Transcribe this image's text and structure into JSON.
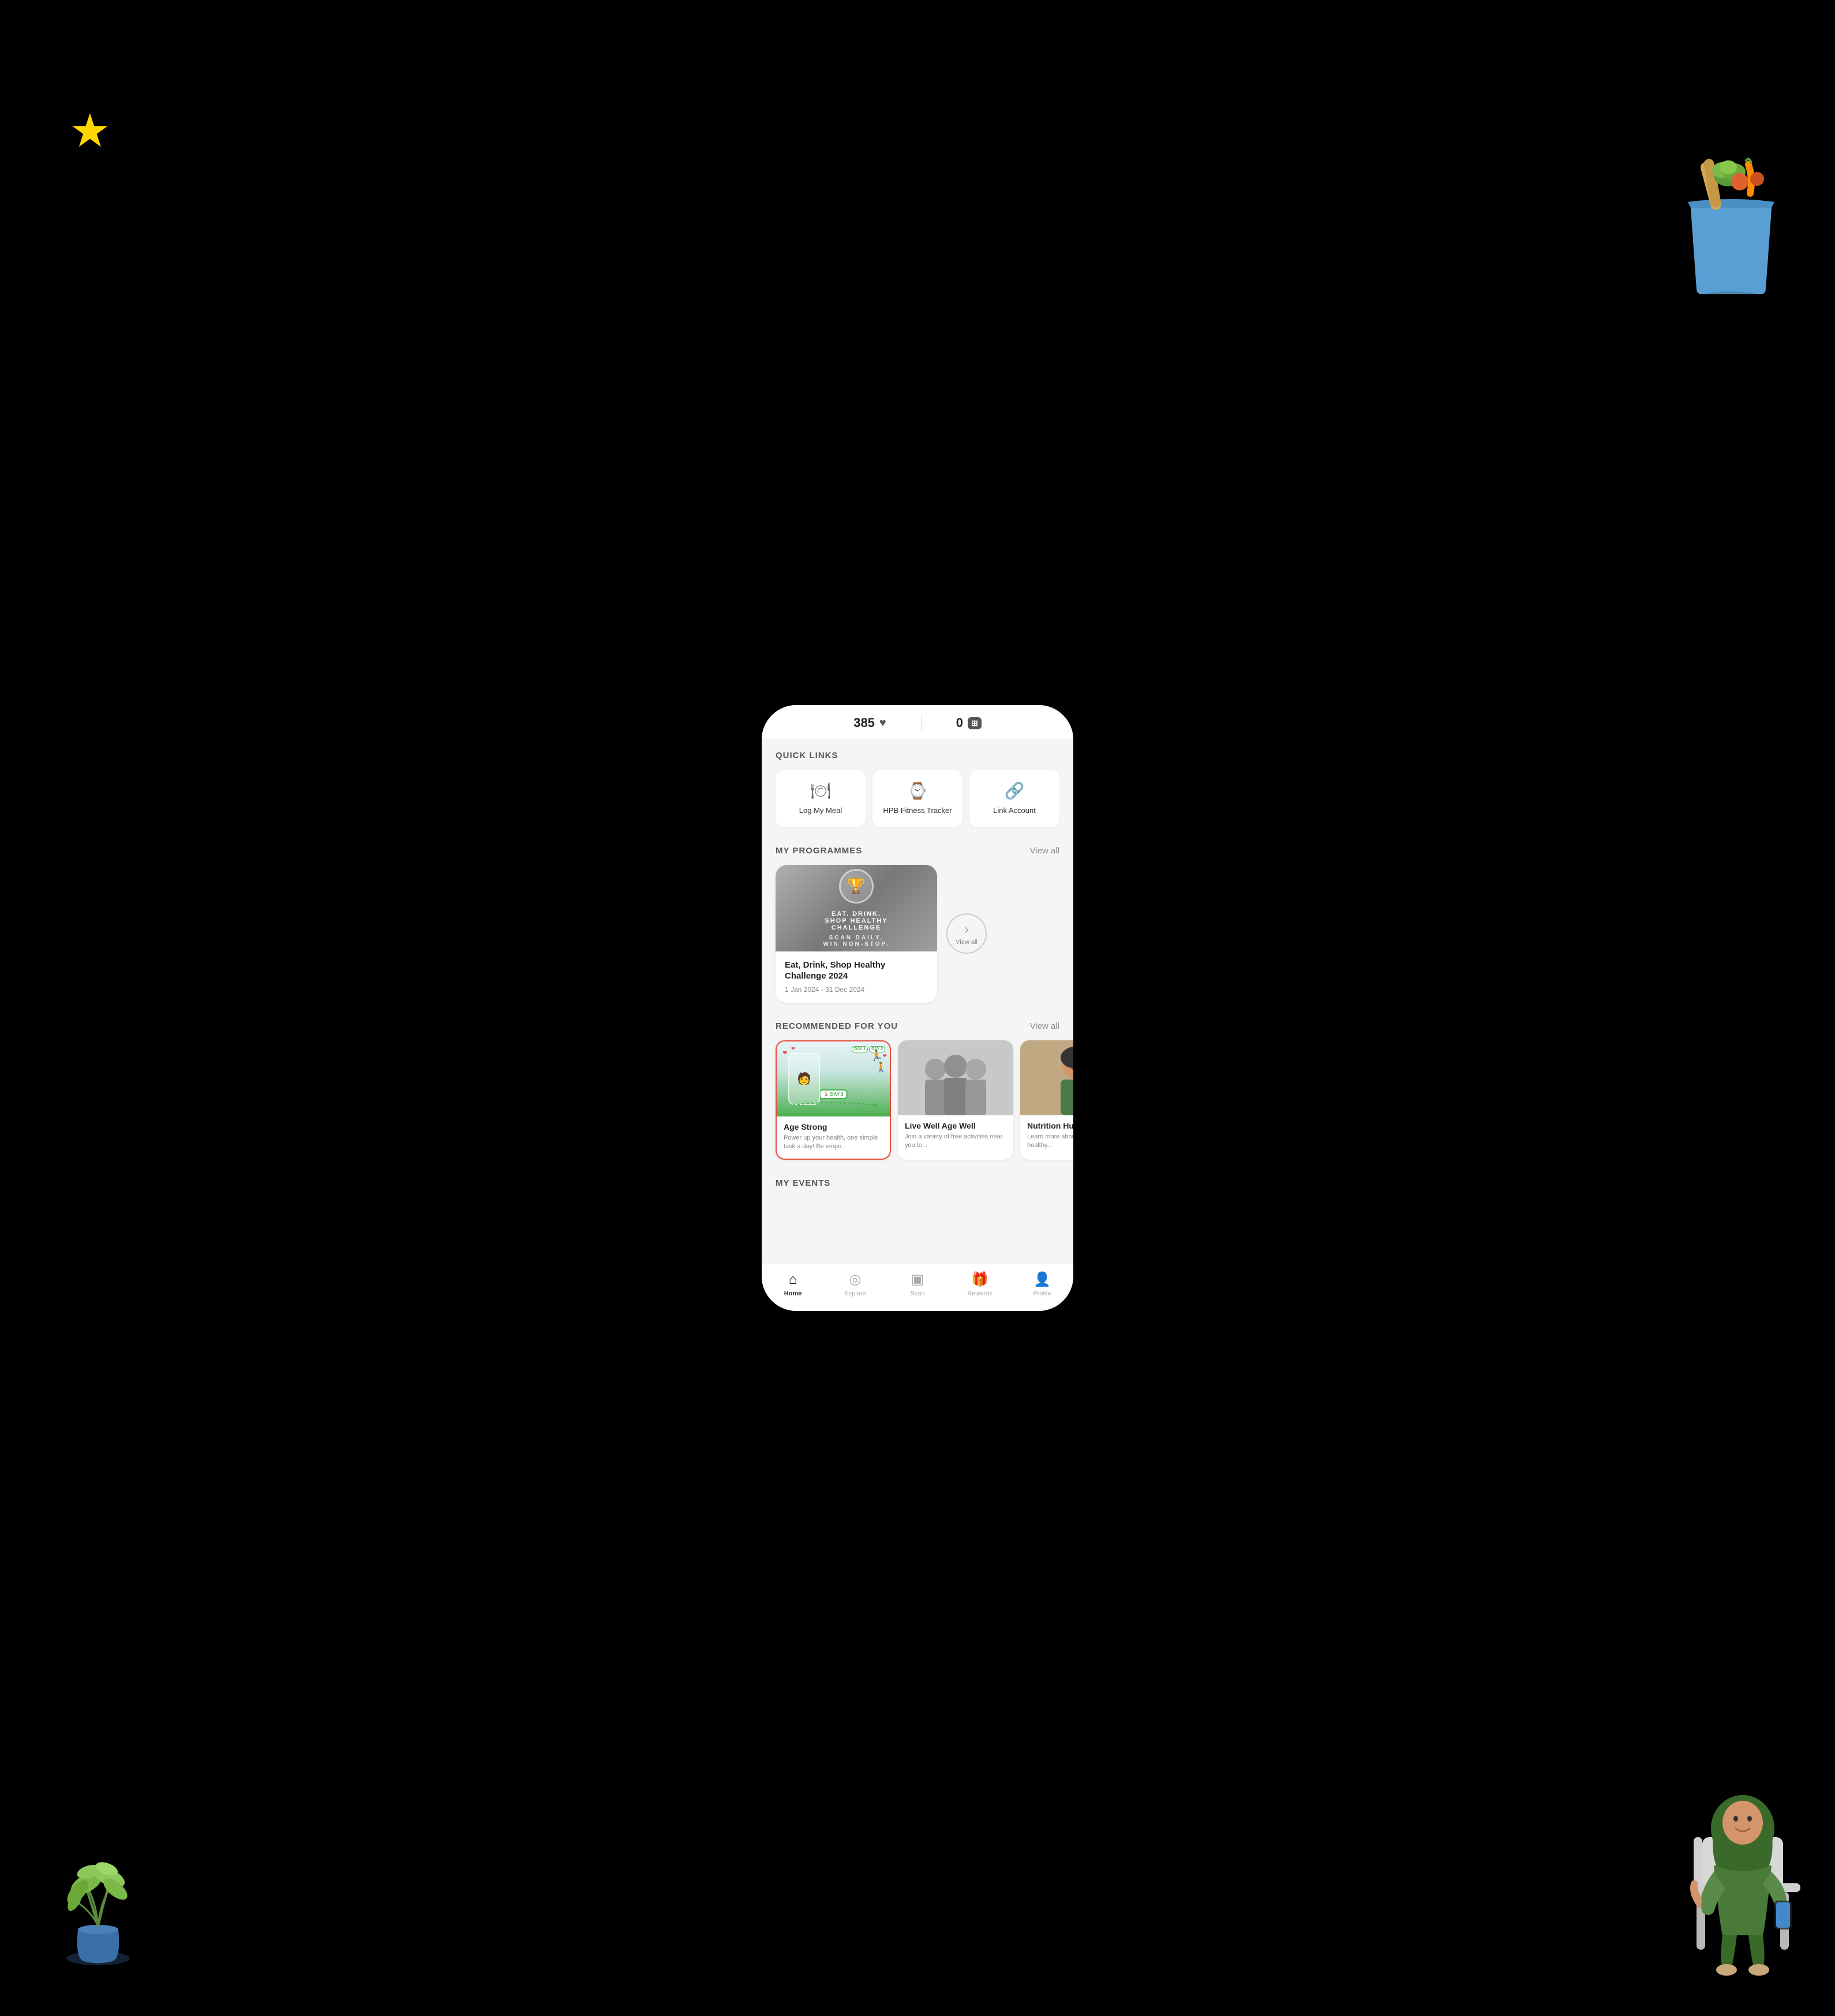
{
  "statusBar": {
    "points": "385",
    "coins": "0",
    "heartIcon": "♥",
    "coinIcon": "⊞"
  },
  "quickLinks": {
    "sectionTitle": "QUICK LINKS",
    "items": [
      {
        "id": "log-meal",
        "label": "Log My Meal",
        "icon": "🍽"
      },
      {
        "id": "hpb-fitness",
        "label": "HPB Fitness Tracker",
        "icon": "⌚"
      },
      {
        "id": "link-account",
        "label": "Link Account",
        "icon": "🔗"
      }
    ]
  },
  "myProgrammes": {
    "sectionTitle": "MY PROGRAMMES",
    "viewAll": "View all",
    "items": [
      {
        "id": "eat-drink",
        "title": "Eat, Drink, Shop Healthy Challenge 2024",
        "date": "1 Jan 2024 - 31 Dec 2024",
        "imageText": "SCAN DAILY. WIN NON-STOP."
      }
    ],
    "viewAllCircle": {
      "icon": "›",
      "label": "View all"
    }
  },
  "recommendedForYou": {
    "sectionTitle": "RECOMMENDED FOR YOU",
    "viewAll": "View all",
    "items": [
      {
        "id": "age-strong",
        "title": "Age Strong",
        "description": "Power up your health, one simple task a day! Be empo...",
        "highlighted": true
      },
      {
        "id": "live-well",
        "title": "Live Well Age Well",
        "description": "Join a variety of free activities near you to...",
        "highlighted": false
      },
      {
        "id": "nutrition-hub",
        "title": "Nutrition Hub",
        "description": "Learn more about nutrition and healthy...",
        "highlighted": false
      }
    ]
  },
  "myEvents": {
    "sectionTitle": "MY EVENTS"
  },
  "bottomNav": {
    "items": [
      {
        "id": "home",
        "label": "Home",
        "icon": "⌂",
        "active": true
      },
      {
        "id": "explore",
        "label": "Explore",
        "icon": "◎",
        "active": false
      },
      {
        "id": "scan",
        "label": "Scan",
        "icon": "▣",
        "active": false
      },
      {
        "id": "rewards",
        "label": "Rewards",
        "icon": "🎁",
        "active": false
      },
      {
        "id": "profile",
        "label": "Profile",
        "icon": "👤",
        "active": false
      }
    ]
  }
}
